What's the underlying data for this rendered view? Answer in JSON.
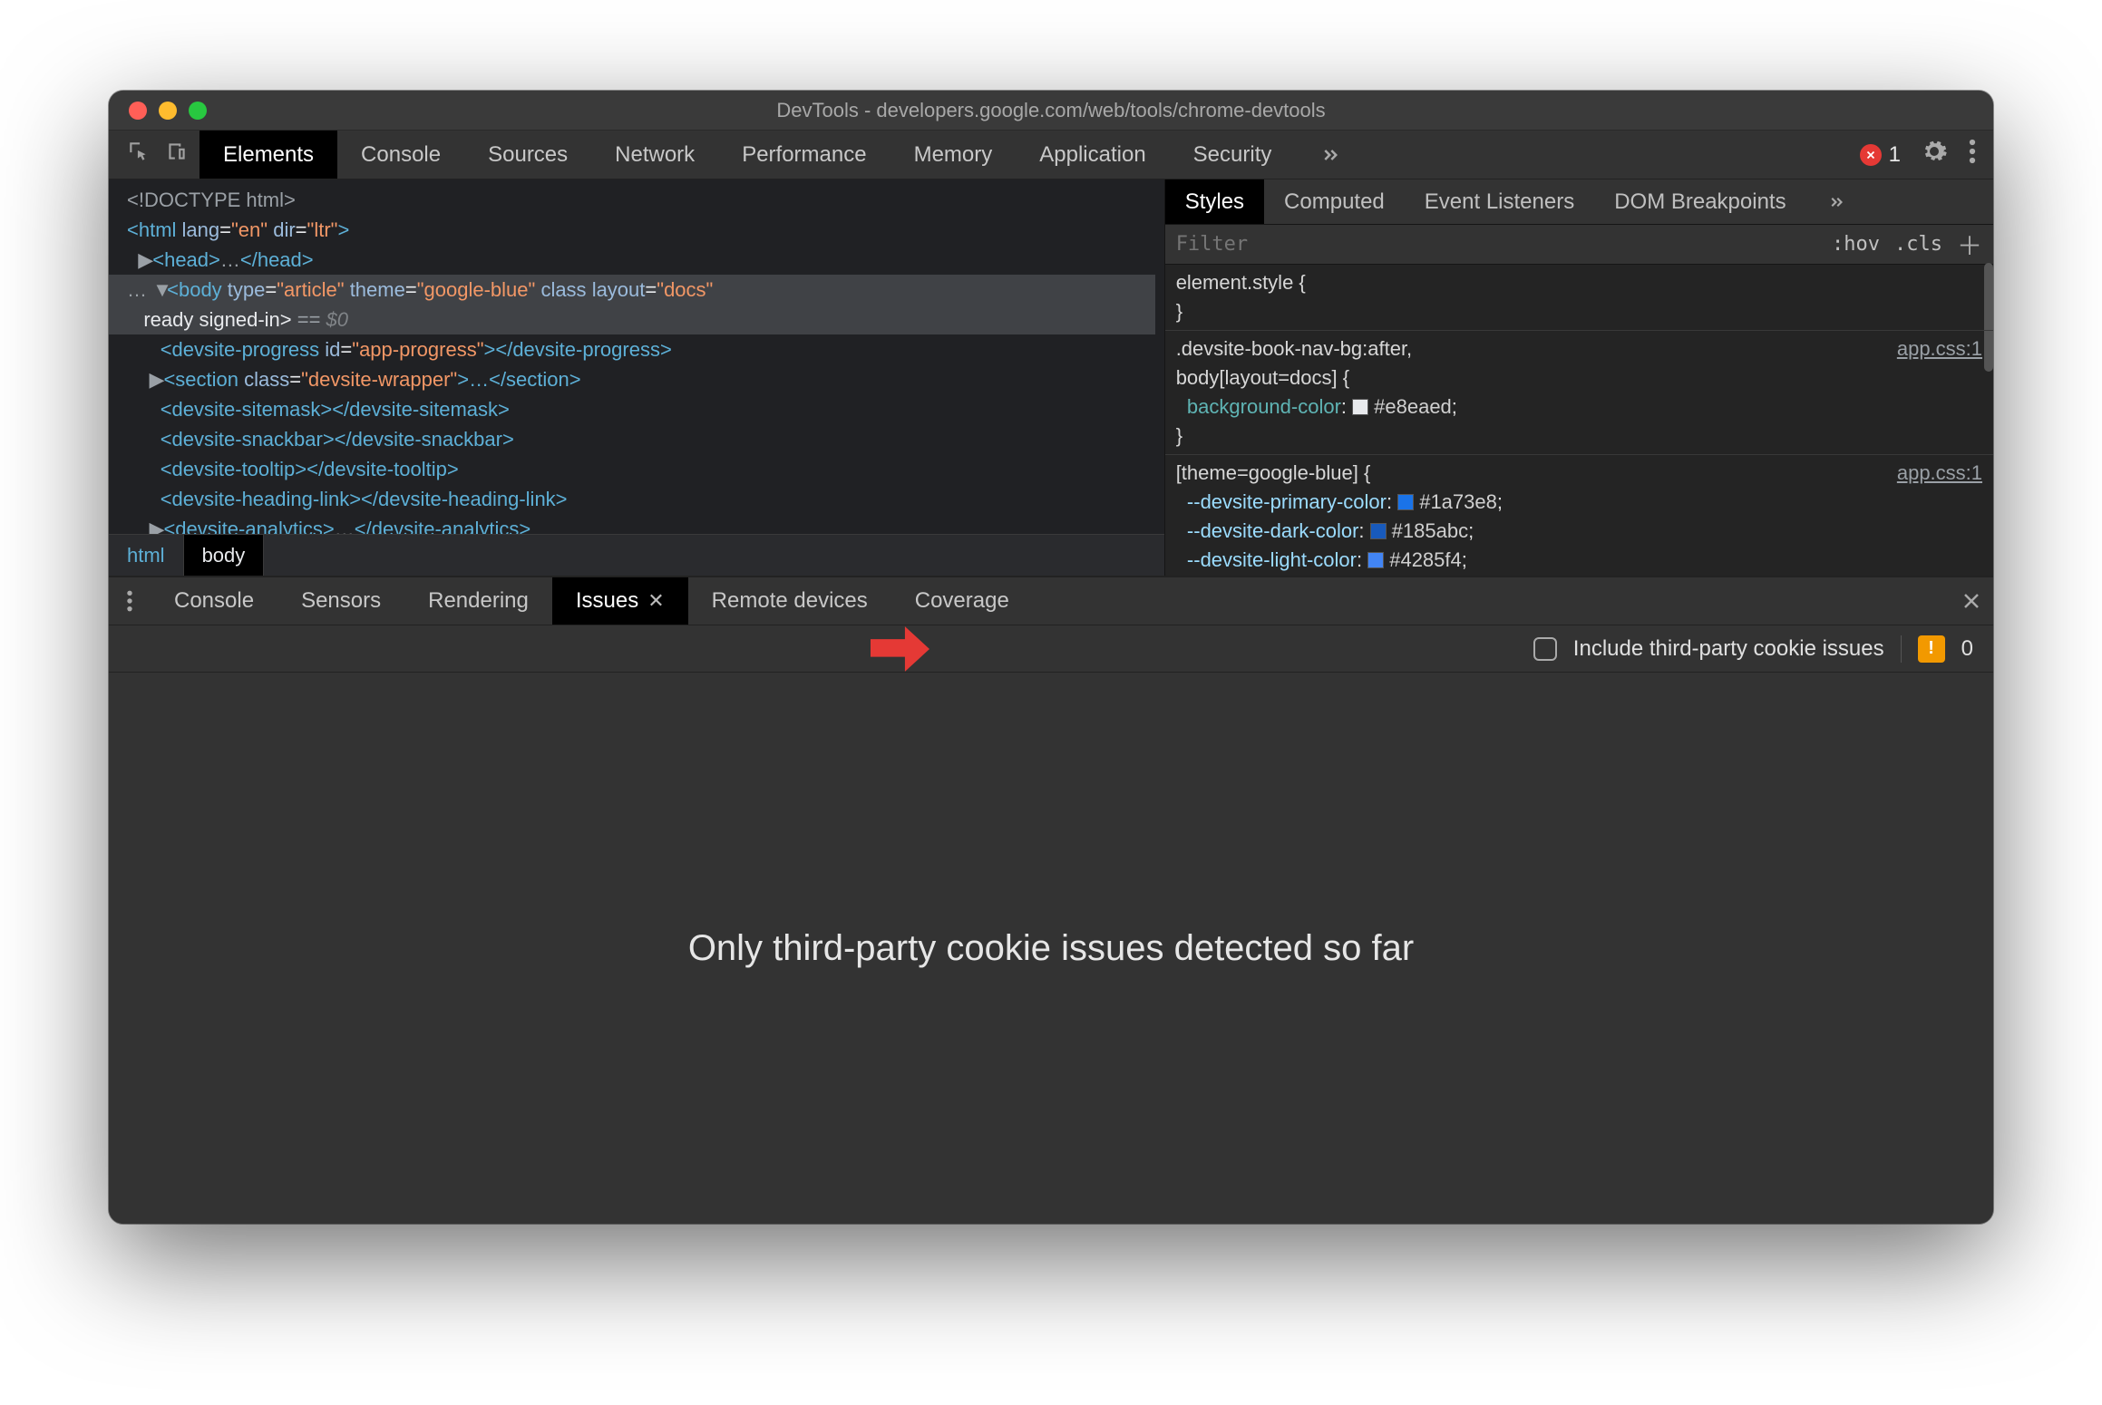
{
  "titlebar": {
    "title": "DevTools - developers.google.com/web/tools/chrome-devtools"
  },
  "main_tabs": [
    "Elements",
    "Console",
    "Sources",
    "Network",
    "Performance",
    "Memory",
    "Application",
    "Security"
  ],
  "main_tabs_active": "Elements",
  "errors": {
    "count": "1"
  },
  "elements": {
    "l1": "<!DOCTYPE html>",
    "l2_open": "<html ",
    "l2_lang_k": "lang",
    "l2_lang_v": "\"en\"",
    "l2_dir_k": "dir",
    "l2_dir_v": "\"ltr\"",
    "l2_close": ">",
    "l3_open": "<head>",
    "l3_dots": "…",
    "l3_close": "</head>",
    "l4_pre": "…",
    "l4_open": "<body ",
    "l4_type_k": "type",
    "l4_type_v": "\"article\"",
    "l4_theme_k": "theme",
    "l4_theme_v": "\"google-blue\"",
    "l4_class_k": "class",
    "l4_layout_k": "layout",
    "l4_layout_v": "\"docs\"",
    "l4b": "ready signed-in>",
    "l4b_eq": " == ",
    "l4b_dollar": "$0",
    "l5_open": "<devsite-progress ",
    "l5_id_k": "id",
    "l5_id_v": "\"app-progress\"",
    "l5_end": "></devsite-progress>",
    "l6_open": "<section ",
    "l6_class_k": "class",
    "l6_class_v": "\"devsite-wrapper\"",
    "l6_end": ">…</section>",
    "l7": "<devsite-sitemask></devsite-sitemask>",
    "l8": "<devsite-snackbar></devsite-snackbar>",
    "l9": "<devsite-tooltip></devsite-tooltip>",
    "l10": "<devsite-heading-link></devsite-heading-link>",
    "l11_open": "<devsite-analytics>",
    "l11_dots": "…",
    "l11_close": "</devsite-analytics>"
  },
  "crumbs": [
    "html",
    "body"
  ],
  "crumbs_active": "body",
  "styles_tabs": [
    "Styles",
    "Computed",
    "Event Listeners",
    "DOM Breakpoints"
  ],
  "styles_tabs_active": "Styles",
  "filter": {
    "placeholder": "Filter",
    "hov": ":hov",
    "cls": ".cls"
  },
  "rules": {
    "r1": {
      "sel": "element.style {",
      "close": "}"
    },
    "r2": {
      "sel1": ".devsite-book-nav-bg:after,",
      "sel2": "body[layout=docs] {",
      "prop": "background-color",
      "val": "#e8eaed",
      "swatch": "#e8eaed",
      "close": "}",
      "src": "app.css:1"
    },
    "r3": {
      "sel": "[theme=google-blue] {",
      "p1": "--devsite-primary-color",
      "v1": "#1a73e8",
      "s1": "#1a73e8",
      "p2": "--devsite-dark-color",
      "v2": "#185abc",
      "s2": "#185abc",
      "p3": "--devsite-light-color",
      "v3": "#4285f4",
      "s3": "#4285f4",
      "src": "app.css:1"
    }
  },
  "drawer_tabs": [
    "Console",
    "Sensors",
    "Rendering",
    "Issues",
    "Remote devices",
    "Coverage"
  ],
  "drawer_tabs_active": "Issues",
  "issues": {
    "include_label": "Include third-party cookie issues",
    "badge_count": "0",
    "empty_msg": "Only third-party cookie issues detected so far"
  }
}
